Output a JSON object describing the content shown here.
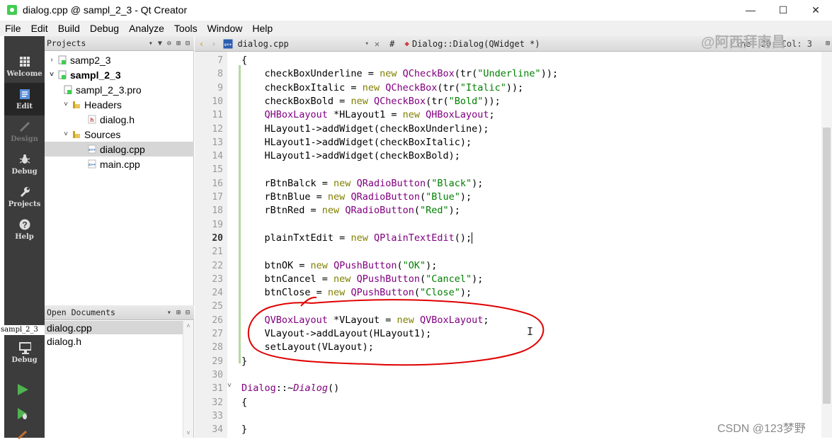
{
  "window": {
    "title": "dialog.cpp @ sampl_2_3 - Qt Creator",
    "controls": [
      "—",
      "☐",
      "✕"
    ]
  },
  "menu": [
    "File",
    "Edit",
    "Build",
    "Debug",
    "Analyze",
    "Tools",
    "Window",
    "Help"
  ],
  "modes": [
    {
      "label": "Welcome",
      "icon": "grid-icon"
    },
    {
      "label": "Edit",
      "icon": "edit-icon"
    },
    {
      "label": "Design",
      "icon": "pencil-icon"
    },
    {
      "label": "Debug",
      "icon": "bug-icon"
    },
    {
      "label": "Projects",
      "icon": "wrench-icon"
    },
    {
      "label": "Help",
      "icon": "help-icon"
    }
  ],
  "kit": {
    "project": "sampl_2_3",
    "label": "Debug"
  },
  "projects_panel": {
    "title": "Projects",
    "tree": [
      {
        "label": "samp2_3",
        "depth": 0,
        "arrow": "›"
      },
      {
        "label": "sampl_2_3",
        "depth": 0,
        "arrow": "˅",
        "bold": true
      },
      {
        "label": "sampl_2_3.pro",
        "depth": 1,
        "arrow": ""
      },
      {
        "label": "Headers",
        "depth": 1,
        "arrow": "˅"
      },
      {
        "label": "dialog.h",
        "depth": 2,
        "arrow": ""
      },
      {
        "label": "Sources",
        "depth": 1,
        "arrow": "˅"
      },
      {
        "label": "dialog.cpp",
        "depth": 2,
        "arrow": "",
        "selected": true
      },
      {
        "label": "main.cpp",
        "depth": 2,
        "arrow": ""
      }
    ]
  },
  "open_documents": {
    "title": "Open Documents",
    "items": [
      "dialog.cpp",
      "dialog.h"
    ]
  },
  "editor": {
    "file_tab": "dialog.cpp",
    "symbol": "Dialog::Dialog(QWidget *)",
    "hash": "#",
    "right_info": "Line: 20, Col: 3"
  },
  "code_lines": [
    {
      "n": "7",
      "t": "{"
    },
    {
      "n": "8",
      "t": "    checkBoxUnderline = new QCheckBox(tr(\"Underline\"));"
    },
    {
      "n": "9",
      "t": "    checkBoxItalic = new QCheckBox(tr(\"Italic\"));"
    },
    {
      "n": "10",
      "t": "    checkBoxBold = new QCheckBox(tr(\"Bold\"));"
    },
    {
      "n": "11",
      "t": "    QHBoxLayout *HLayout1 = new QHBoxLayout;"
    },
    {
      "n": "12",
      "t": "    HLayout1->addWidget(checkBoxUnderline);"
    },
    {
      "n": "13",
      "t": "    HLayout1->addWidget(checkBoxItalic);"
    },
    {
      "n": "14",
      "t": "    HLayout1->addWidget(checkBoxBold);"
    },
    {
      "n": "15",
      "t": ""
    },
    {
      "n": "16",
      "t": "    rBtnBalck = new QRadioButton(\"Black\");"
    },
    {
      "n": "17",
      "t": "    rBtnBlue = new QRadioButton(\"Blue\");"
    },
    {
      "n": "18",
      "t": "    rBtnRed = new QRadioButton(\"Red\");"
    },
    {
      "n": "19",
      "t": ""
    },
    {
      "n": "20",
      "t": "    plainTxtEdit = new QPlainTextEdit();"
    },
    {
      "n": "21",
      "t": ""
    },
    {
      "n": "22",
      "t": "    btnOK = new QPushButton(\"OK\");"
    },
    {
      "n": "23",
      "t": "    btnCancel = new QPushButton(\"Cancel\");"
    },
    {
      "n": "24",
      "t": "    btnClose = new QPushButton(\"Close\");"
    },
    {
      "n": "25",
      "t": ""
    },
    {
      "n": "26",
      "t": "    QVBoxLayout *VLayout = new QVBoxLayout;"
    },
    {
      "n": "27",
      "t": "    VLayout->addLayout(HLayout1);"
    },
    {
      "n": "28",
      "t": "    setLayout(VLayout);"
    },
    {
      "n": "29",
      "t": "}"
    },
    {
      "n": "30",
      "t": ""
    },
    {
      "n": "31",
      "t": "Dialog::~Dialog()"
    },
    {
      "n": "32",
      "t": "{"
    },
    {
      "n": "33",
      "t": ""
    },
    {
      "n": "34",
      "t": "}"
    }
  ],
  "current_line": "20",
  "watermarks": {
    "top": "@阿西拜南昌",
    "bottom": "CSDN @123梦野"
  },
  "colors": {
    "keyword": "#808000",
    "class": "#800080",
    "string": "#008000",
    "annotation": "#e00000"
  }
}
